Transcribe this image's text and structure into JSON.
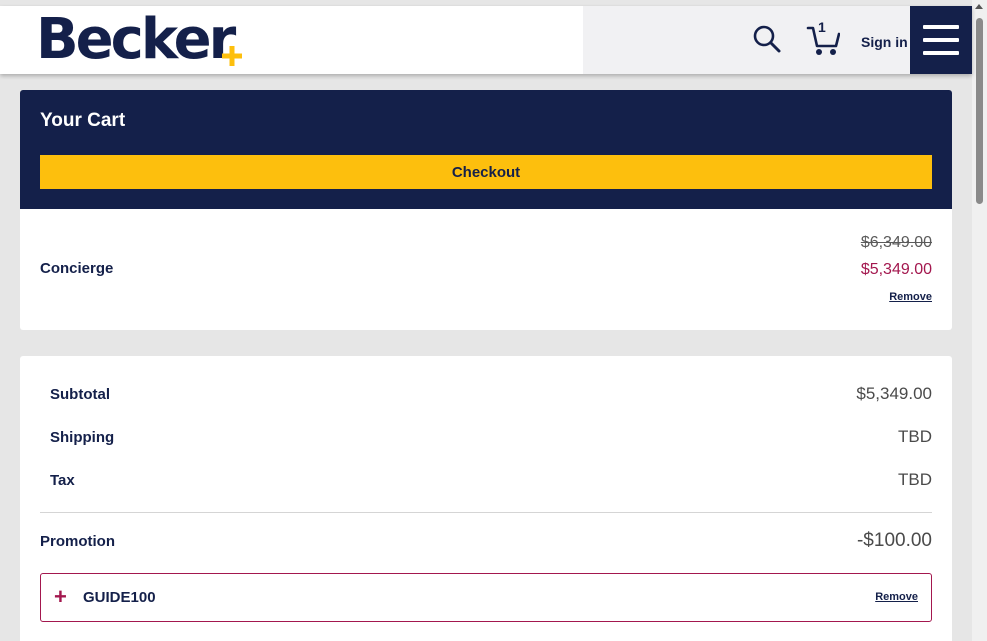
{
  "header": {
    "logo_text": "Becker",
    "cart_count": "1",
    "signin_label": "Sign in",
    "icons": [
      "search-icon",
      "cart-icon",
      "menu-icon"
    ],
    "colors": {
      "navy": "#14204a",
      "gold": "#fdbf0d",
      "magenta": "#a3174e"
    }
  },
  "cart": {
    "title": "Your Cart",
    "checkout_label": "Checkout",
    "item": {
      "name": "Concierge",
      "original_price": "$6,349.00",
      "sale_price": "$5,349.00",
      "remove_label": "Remove"
    }
  },
  "summary": {
    "subtotal_label": "Subtotal",
    "subtotal_value": "$5,349.00",
    "shipping_label": "Shipping",
    "shipping_value": "TBD",
    "tax_label": "Tax",
    "tax_value": "TBD",
    "promotion_label": "Promotion",
    "promotion_value": "-$100.00",
    "coupon": {
      "code": "GUIDE100",
      "remove_label": "Remove"
    }
  }
}
